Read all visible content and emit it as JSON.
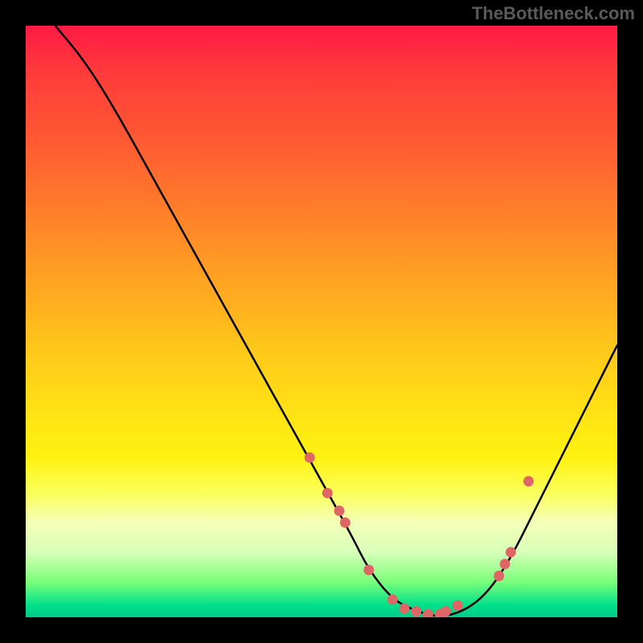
{
  "attribution": "TheBottleneck.com",
  "chart_data": {
    "type": "line",
    "title": "",
    "xlabel": "",
    "ylabel": "",
    "xlim": [
      0,
      100
    ],
    "ylim": [
      0,
      100
    ],
    "grid": false,
    "legend_position": "none",
    "series": [
      {
        "name": "bottleneck-curve",
        "x": [
          5,
          10,
          15,
          20,
          25,
          30,
          35,
          40,
          45,
          50,
          55,
          58,
          62,
          66,
          70,
          74,
          78,
          82,
          86,
          90,
          94,
          100
        ],
        "y": [
          100,
          94,
          86,
          77,
          68,
          59,
          50,
          41,
          32,
          23,
          14,
          8,
          3,
          1,
          0,
          1,
          4,
          10,
          18,
          26,
          34,
          46
        ],
        "color": "#000000"
      }
    ],
    "scatter_points": {
      "name": "highlighted-points",
      "color": "#e06666",
      "x": [
        48,
        51,
        53,
        54,
        58,
        62,
        64,
        66,
        68,
        70,
        71,
        73,
        80,
        81,
        82,
        85
      ],
      "y": [
        27,
        21,
        18,
        16,
        8,
        3,
        1.5,
        1,
        0.5,
        0.5,
        1,
        2,
        7,
        9,
        11,
        23
      ]
    },
    "gradient_stops": [
      {
        "pos": 0,
        "color": "#ff1a44"
      },
      {
        "pos": 8,
        "color": "#ff3b3b"
      },
      {
        "pos": 18,
        "color": "#ff5533"
      },
      {
        "pos": 30,
        "color": "#ff7a2a"
      },
      {
        "pos": 42,
        "color": "#ffa022"
      },
      {
        "pos": 55,
        "color": "#ffc81a"
      },
      {
        "pos": 66,
        "color": "#ffe414"
      },
      {
        "pos": 73,
        "color": "#fff210"
      },
      {
        "pos": 79,
        "color": "#fbff5a"
      },
      {
        "pos": 84,
        "color": "#f4ffb8"
      },
      {
        "pos": 89,
        "color": "#d8ffb8"
      },
      {
        "pos": 94,
        "color": "#7aff7a"
      },
      {
        "pos": 98,
        "color": "#00e08a"
      },
      {
        "pos": 100,
        "color": "#00cc88"
      }
    ]
  }
}
